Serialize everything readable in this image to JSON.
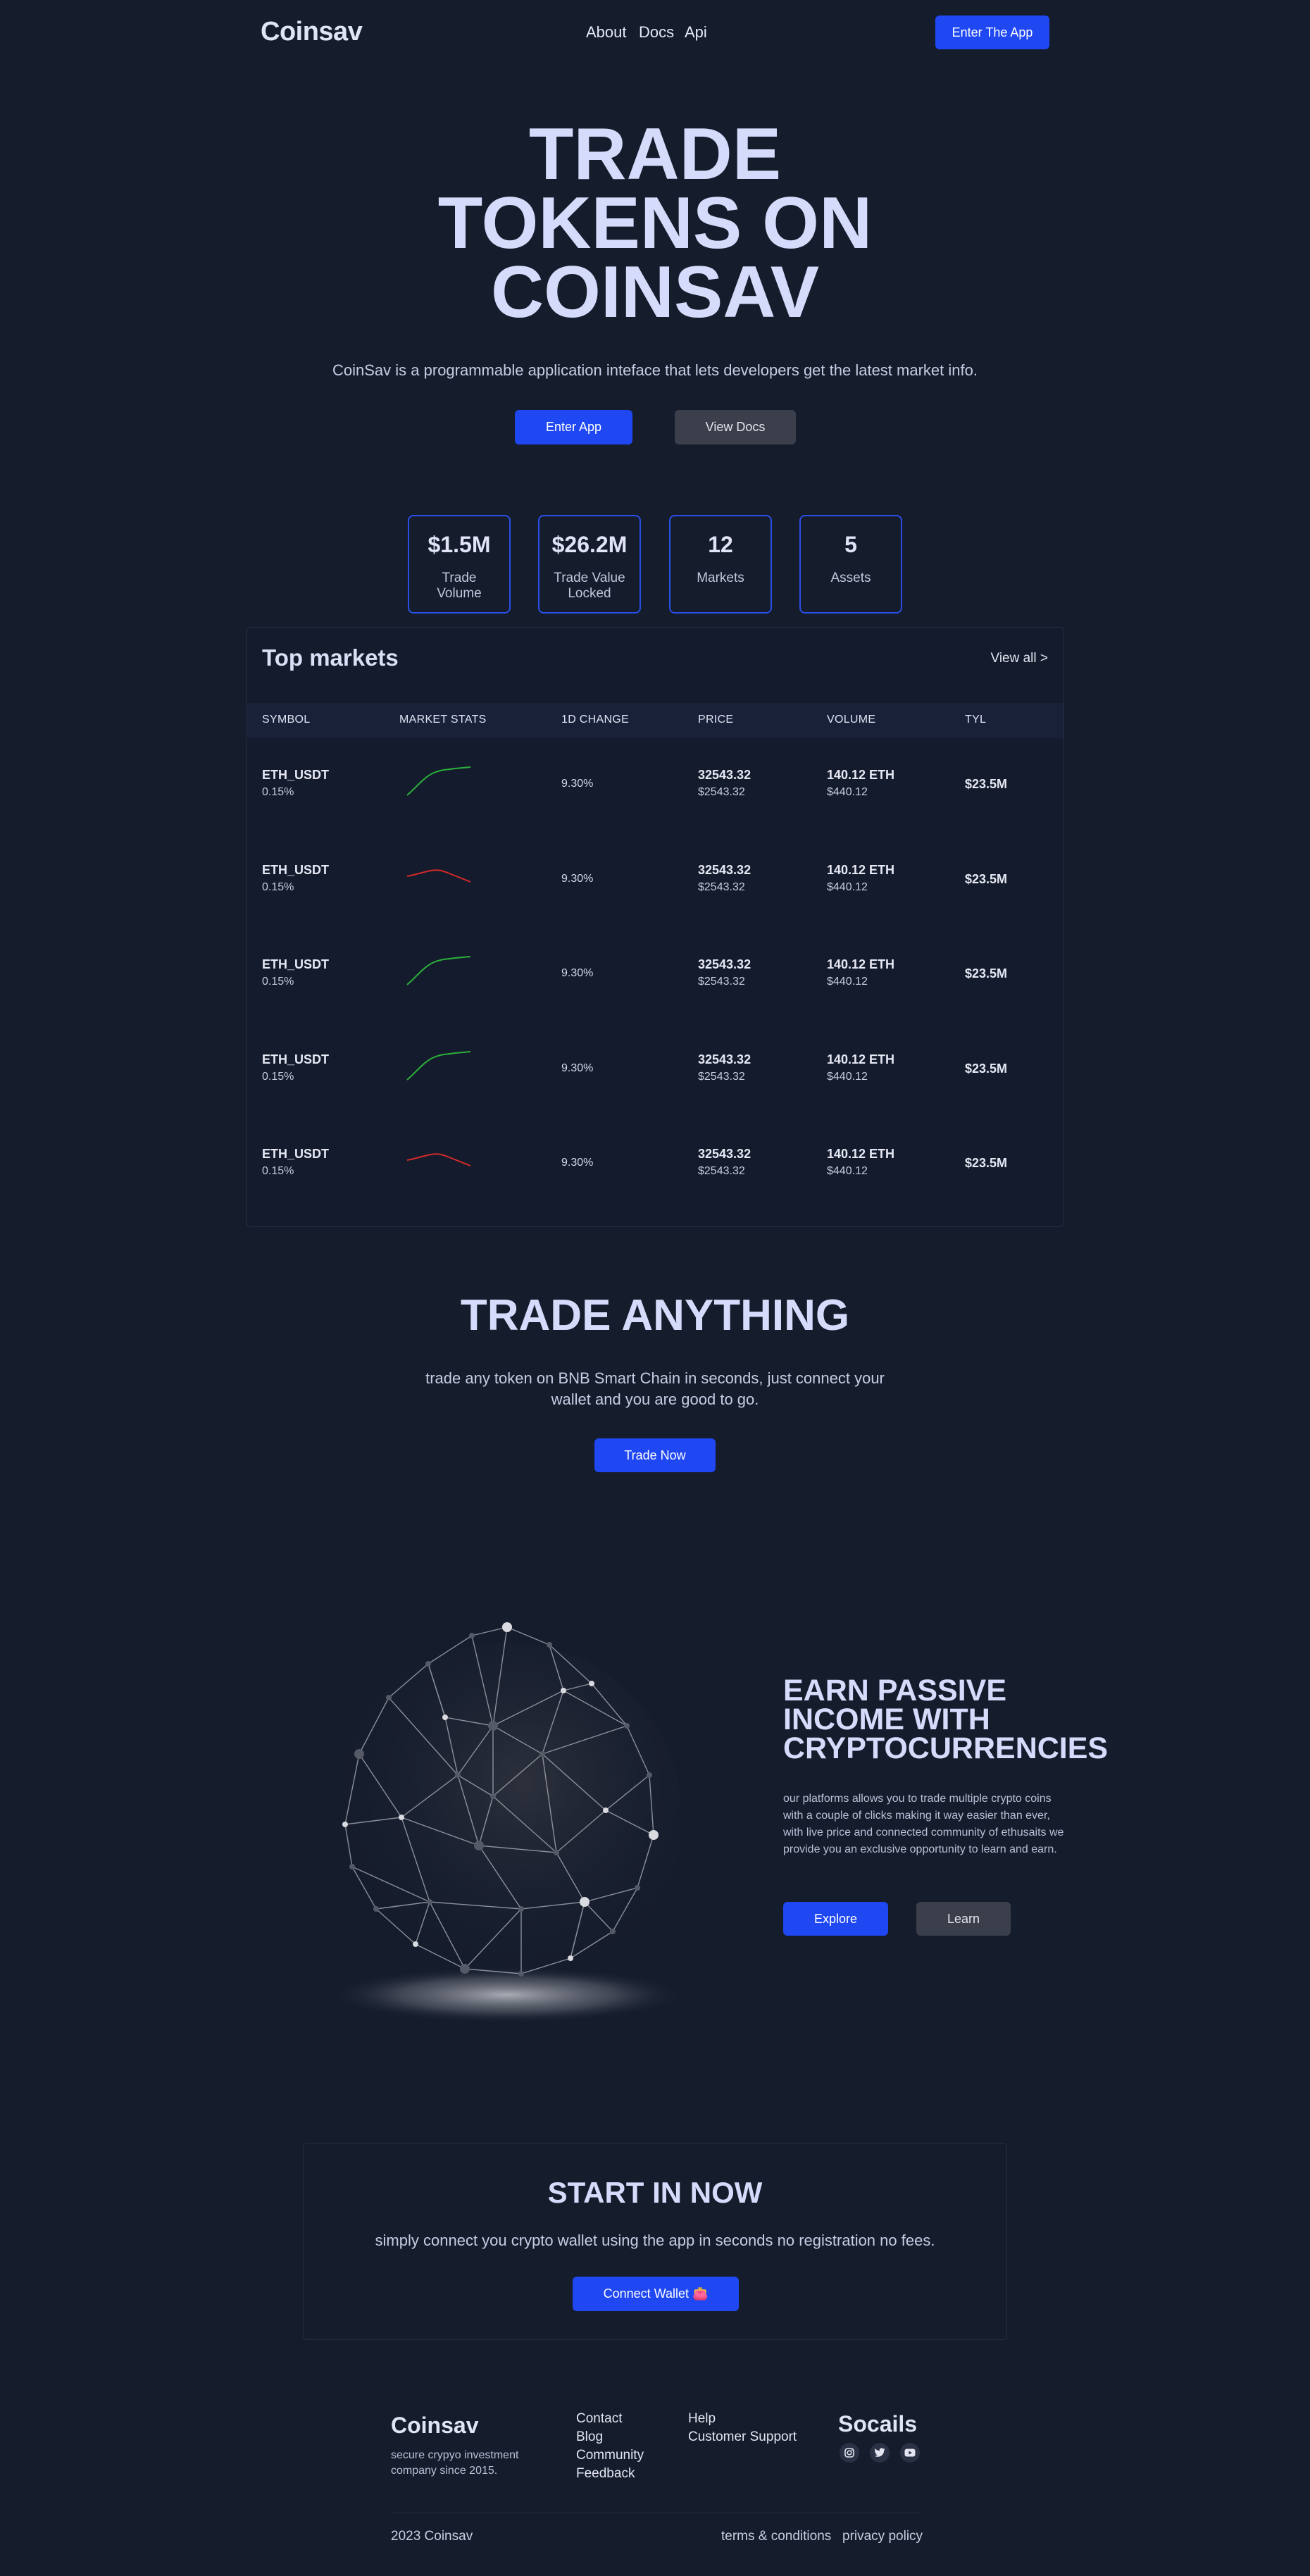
{
  "nav": {
    "logo": "Coinsav",
    "links": [
      "About",
      "Docs",
      "Api"
    ],
    "cta": "Enter The App"
  },
  "hero": {
    "title_lines": [
      "TRADE",
      "TOKENS ON",
      "COINSAV"
    ],
    "subtitle": "CoinSav is a programmable application inteface that lets developers get the latest market info.",
    "primary": "Enter App",
    "secondary": "View Docs"
  },
  "stats": [
    {
      "value": "$1.5M",
      "label": "Trade Volume"
    },
    {
      "value": "$26.2M",
      "label": "Trade Value Locked"
    },
    {
      "value": "12",
      "label": "Markets"
    },
    {
      "value": "5",
      "label": "Assets"
    }
  ],
  "markets": {
    "title": "Top markets",
    "view_all": "View all >",
    "columns": [
      "SYMBOL",
      "MARKET STATS",
      "1D CHANGE",
      "PRICE",
      "VOLUME",
      "TYL"
    ],
    "rows": [
      {
        "symbol": "ETH_USDT",
        "symbol_sub": "0.15%",
        "trend": "up",
        "change": "9.30%",
        "price": "32543.32",
        "price_sub": "$2543.32",
        "volume": "140.12 ETH",
        "volume_sub": "$440.12",
        "tyl": "$23.5M"
      },
      {
        "symbol": "ETH_USDT",
        "symbol_sub": "0.15%",
        "trend": "down",
        "change": "9.30%",
        "price": "32543.32",
        "price_sub": "$2543.32",
        "volume": "140.12 ETH",
        "volume_sub": "$440.12",
        "tyl": "$23.5M"
      },
      {
        "symbol": "ETH_USDT",
        "symbol_sub": "0.15%",
        "trend": "up",
        "change": "9.30%",
        "price": "32543.32",
        "price_sub": "$2543.32",
        "volume": "140.12 ETH",
        "volume_sub": "$440.12",
        "tyl": "$23.5M"
      },
      {
        "symbol": "ETH_USDT",
        "symbol_sub": "0.15%",
        "trend": "up",
        "change": "9.30%",
        "price": "32543.32",
        "price_sub": "$2543.32",
        "volume": "140.12 ETH",
        "volume_sub": "$440.12",
        "tyl": "$23.5M"
      },
      {
        "symbol": "ETH_USDT",
        "symbol_sub": "0.15%",
        "trend": "down",
        "change": "9.30%",
        "price": "32543.32",
        "price_sub": "$2543.32",
        "volume": "140.12 ETH",
        "volume_sub": "$440.12",
        "tyl": "$23.5M"
      }
    ]
  },
  "trade": {
    "title": "TRADE ANYTHING",
    "subtitle": "trade any token on BNB Smart Chain in seconds, just connect your wallet and you are good to go.",
    "button": "Trade Now"
  },
  "earn": {
    "title_lines": [
      "EARN PASSIVE",
      "INCOME WITH",
      "CRYPTOCURRENCIES"
    ],
    "text": "our platforms allows you to trade multiple crypto coins with a couple of clicks making it way easier than ever, with live price and connected community of ethusaits we provide you an exclusive opportunity to learn and earn.",
    "primary": "Explore",
    "secondary": "Learn"
  },
  "start": {
    "title": "START IN NOW",
    "subtitle": "simply connect you crypto wallet using the app in seconds no registration no fees.",
    "button": "Connect Wallet 👛"
  },
  "footer": {
    "logo": "Coinsav",
    "description": "secure crypyo investment company since 2015.",
    "links_col1": [
      "Contact",
      "Blog",
      "Community",
      "Feedback"
    ],
    "links_col2": [
      "Help",
      "Customer Support"
    ],
    "socials_title": "Socails",
    "social_icons": [
      "instagram-icon",
      "twitter-icon",
      "youtube-icon"
    ],
    "copyright": "2023 Coinsav",
    "terms": "terms & conditions",
    "privacy": "privacy policy"
  },
  "colors": {
    "background": "#151c2c",
    "accent": "#1f47f2",
    "up": "#2bb03a",
    "down": "#d42a2a"
  }
}
